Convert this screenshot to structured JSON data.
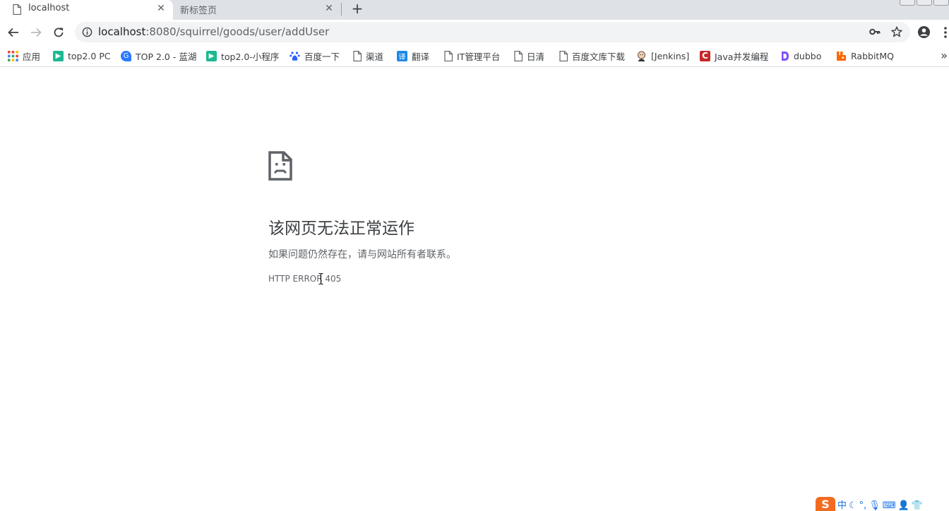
{
  "tabs": [
    {
      "title": "localhost",
      "active": true
    },
    {
      "title": "新标签页",
      "active": false
    }
  ],
  "toolbar": {
    "url_host": "localhost",
    "url_rest": ":8080/squirrel/goods/user/addUser"
  },
  "bookmarks": [
    {
      "label": "应用",
      "icon": "apps-grid-icon",
      "color": "#e53935"
    },
    {
      "label": "top2.0 PC",
      "icon": "green-play-icon",
      "color": "#1db992"
    },
    {
      "label": "TOP 2.0 - 蓝湖",
      "icon": "lanhu-icon",
      "color": "#2979ff"
    },
    {
      "label": "top2.0-小程序",
      "icon": "green-play-icon",
      "color": "#1db992"
    },
    {
      "label": "百度一下",
      "icon": "baidu-paw-icon",
      "color": "#2962ff"
    },
    {
      "label": "渠道",
      "icon": "page-icon",
      "color": "#5f6368"
    },
    {
      "label": "翻译",
      "icon": "translate-icon",
      "color": "#1e88e5"
    },
    {
      "label": "IT管理平台",
      "icon": "page-icon",
      "color": "#5f6368"
    },
    {
      "label": "日清",
      "icon": "page-icon",
      "color": "#5f6368"
    },
    {
      "label": "百度文库下载",
      "icon": "page-icon",
      "color": "#5f6368"
    },
    {
      "label": "[Jenkins]",
      "icon": "jenkins-icon",
      "color": "#d4a373"
    },
    {
      "label": "Java并发编程",
      "icon": "csdn-icon",
      "color": "#c62828"
    },
    {
      "label": "dubbo",
      "icon": "dubbo-icon",
      "color": "#7c4dff"
    },
    {
      "label": "RabbitMQ",
      "icon": "rabbitmq-icon",
      "color": "#ff6600"
    }
  ],
  "error": {
    "heading": "该网页无法正常运作",
    "message": "如果问题仍然存在，请与网站所有者联系。",
    "code": "HTTP ERROR 405"
  },
  "tray": {
    "ime_label": "中"
  },
  "colors": {
    "tabstrip": "#dee1e6",
    "omnibox": "#f1f3f4",
    "text_secondary": "#5f6368"
  }
}
